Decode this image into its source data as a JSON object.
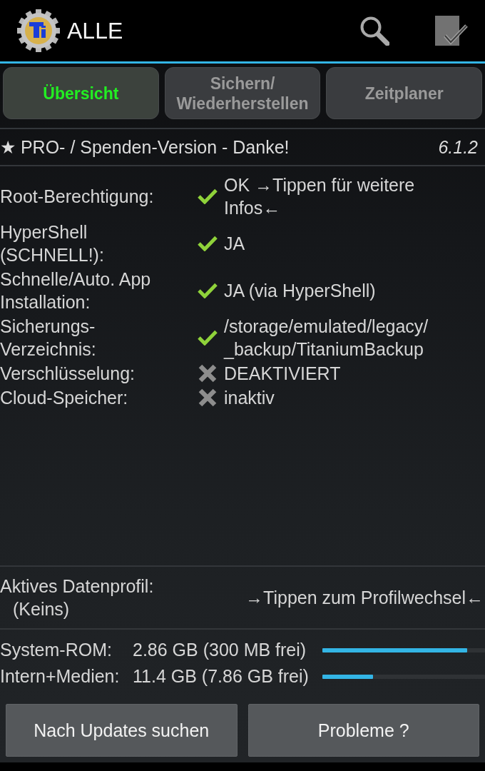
{
  "header": {
    "title": "ALLE"
  },
  "tabs": [
    {
      "label": "Übersicht",
      "selected": true
    },
    {
      "label": "Sichern/Wiederherstellen",
      "selected": false
    },
    {
      "label": "Zeitplaner",
      "selected": false
    }
  ],
  "license": {
    "text": "★ PRO- / Spenden-Version - Danke!",
    "version": "6.1.2"
  },
  "status_rows": [
    {
      "label": "Root-Berechtigung:",
      "ok": true,
      "value": "OK →Tippen für weitere Infos←"
    },
    {
      "label": "HyperShell (SCHNELL!):",
      "ok": true,
      "value": "JA"
    },
    {
      "label": "Schnelle/Auto. App Installation:",
      "ok": true,
      "value": "JA (via HyperShell)"
    },
    {
      "label": "Sicherungs-Verzeichnis:",
      "ok": true,
      "value": "/storage/emulated/legacy/_backup/TitaniumBackup"
    },
    {
      "label": "Verschlüsselung:",
      "ok": false,
      "value": "DEAKTIVIERT"
    },
    {
      "label": "Cloud-Speicher:",
      "ok": false,
      "value": "inaktiv"
    }
  ],
  "profile": {
    "label": "Aktives Datenprofil:",
    "value": "(Keins)",
    "action": "→Tippen zum Profilwechsel←"
  },
  "storage": [
    {
      "label": "System-ROM:",
      "value": "2.86 GB (300 MB frei)",
      "level": 0.89
    },
    {
      "label": "Intern+Medien:",
      "value": "11.4 GB (7.86 GB frei)",
      "level": 0.31
    }
  ],
  "buttons": [
    "Nach Updates suchen",
    "Probleme ?"
  ]
}
